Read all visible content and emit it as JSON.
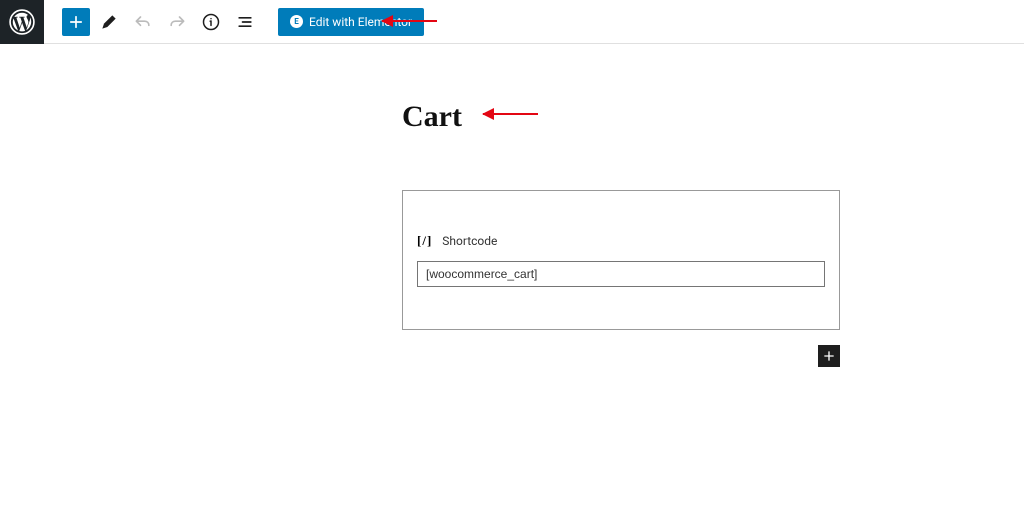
{
  "toolbar": {
    "elementor_label": "Edit with Elementor",
    "elementor_icon_label": "E"
  },
  "page": {
    "title": "Cart"
  },
  "block": {
    "label": "Shortcode",
    "value": "[woocommerce_cart]"
  }
}
